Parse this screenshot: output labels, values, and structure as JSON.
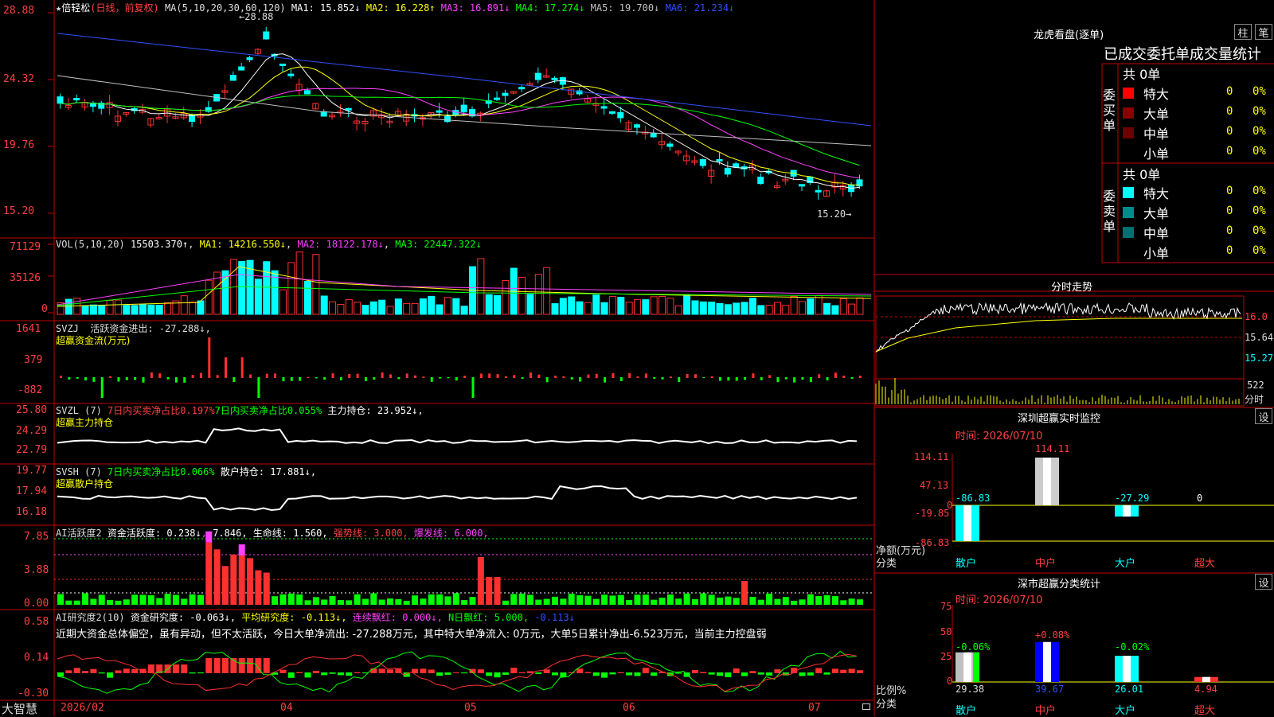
{
  "app": {
    "name": "大智慧",
    "date_start": "2026/02"
  },
  "price_panel": {
    "title": "倍轻松",
    "period": "(日线，前复权)",
    "ma_label": "MA(5,10,20,30,60,120)",
    "ma1": "MA1: 15.852↓",
    "ma2": "MA2: 16.228↑",
    "ma3": "MA3: 16.891↓",
    "ma4": "MA4: 17.274↓",
    "ma5": "MA5: 19.700↓",
    "ma6": "MA6: 21.234↓",
    "y_ticks": [
      "28.88",
      "24.32",
      "19.76",
      "15.20"
    ],
    "high_label": "←28.88",
    "low_label": "15.20→"
  },
  "vol_panel": {
    "label": "VOL(5,10,20)",
    "value": "15503.370↑",
    "ma1": "MA1: 14216.550↓",
    "ma2": "MA2: 18122.178↓",
    "ma3": "MA3: 22447.322↓",
    "y_ticks": [
      "71129",
      "35126",
      "0"
    ]
  },
  "svzj_panel": {
    "label": "SVZJ",
    "line": "活跃资金进出: -27.288↓,",
    "subtitle": "超赢资金流(万元)",
    "y_ticks": [
      "1641",
      "379",
      "-882"
    ]
  },
  "svzl_panel": {
    "label": "SVZL (7)",
    "l1": "7日内买卖净占比0.197%",
    "l2": "7日内买卖净占比0.055%",
    "l3": "主力持仓: 23.952↓,",
    "subtitle": "超赢主力持仓",
    "y_ticks": [
      "25.80",
      "24.29",
      "22.79"
    ]
  },
  "svsh_panel": {
    "label": "SVSH (7)",
    "l1": "7日内买卖净占比0.066%",
    "l2": "散户持仓: 17.881↓,",
    "subtitle": "超赢散户持仓",
    "y_ticks": [
      "19.77",
      "17.94",
      "16.18"
    ]
  },
  "ai_active_panel": {
    "label": "AI活跃度2",
    "l1": "资金活跃度: 0.238↓",
    "l2": "7.846,",
    "l3": "生命线: 1.560,",
    "l4": "强势线: 3.000,",
    "l5": "爆发线: 6.000,",
    "y_ticks": [
      "7.85",
      "3.88",
      "0.00"
    ]
  },
  "ai_research_panel": {
    "label": "AI研究度2(10)",
    "l1": "资金研究度: -0.063↓,",
    "l2": "平均研究度: -0.113↓,",
    "l3": "连续飘红: 0.000↓,",
    "l4": "N日飘红: 5.000,",
    "l5": "-0.113↓",
    "commentary": "近期大资金总体偏空，虽有异动，但不太活跃，今日大单净流出: -27.288万元，其中特大单净流入: 0万元，大单5日累计净出-6.523万元，当前主力控盘弱",
    "y_ticks": [
      "0.58",
      "0.14",
      "-0.30"
    ]
  },
  "x_axis": {
    "labels": [
      "2026/02",
      "04",
      "05",
      "06",
      "07"
    ]
  },
  "longhu": {
    "title": "龙虎看盘(逐单)",
    "btn_bar": "柱",
    "btn_pen": "笔",
    "header": "已成交委托单成交量统计",
    "buy_label": "委买单",
    "sell_label": "委卖单",
    "buy_total": "共 0单",
    "sell_total": "共 0单",
    "buy_rows": [
      {
        "name": "特大",
        "count": "0",
        "pct": "0%",
        "color": "#ff0000"
      },
      {
        "name": "大单",
        "count": "0",
        "pct": "0%",
        "color": "#8b0000"
      },
      {
        "name": "中单",
        "count": "0",
        "pct": "0%",
        "color": "#700000"
      },
      {
        "name": "小单",
        "count": "0",
        "pct": "0%",
        "color": "#000000"
      }
    ],
    "sell_rows": [
      {
        "name": "特大",
        "count": "0",
        "pct": "0%",
        "color": "#00ffff"
      },
      {
        "name": "大单",
        "count": "0",
        "pct": "0%",
        "color": "#008b8b"
      },
      {
        "name": "中单",
        "count": "0",
        "pct": "0%",
        "color": "#007070"
      },
      {
        "name": "小单",
        "count": "0",
        "pct": "0%",
        "color": "#000000"
      }
    ]
  },
  "intraday": {
    "title": "分时走势",
    "p1": "16.0",
    "p2": "15.64",
    "p3": "15.27",
    "vol": "522",
    "unit": "分时"
  },
  "sz_monitor": {
    "title": "深圳超赢实时监控",
    "btn": "设",
    "time": "时间: 2026/07/10",
    "y_ticks": [
      "114.11",
      "47.13",
      "0",
      "-19.85",
      "-86.83"
    ],
    "ylabel": "净额(万元)",
    "xlabel": "分类",
    "categories": [
      "散户",
      "中户",
      "大户",
      "超大"
    ],
    "values": [
      -86.83,
      114.11,
      -27.29,
      0
    ],
    "value_labels": [
      "-86.83",
      "114.11",
      "-27.29",
      "0"
    ]
  },
  "sz_class": {
    "title": "深市超赢分类统计",
    "btn": "设",
    "time": "时间: 2026/07/10",
    "y_ticks": [
      "75",
      "50",
      "25",
      "0"
    ],
    "ylabel": "比例%",
    "xlabel": "分类",
    "categories": [
      "散户",
      "中户",
      "大户",
      "超大"
    ],
    "values": [
      29.38,
      39.67,
      26.01,
      4.94
    ],
    "change_labels": [
      "-0.06%",
      "+0.08%",
      "-0.02%",
      ""
    ]
  }
}
